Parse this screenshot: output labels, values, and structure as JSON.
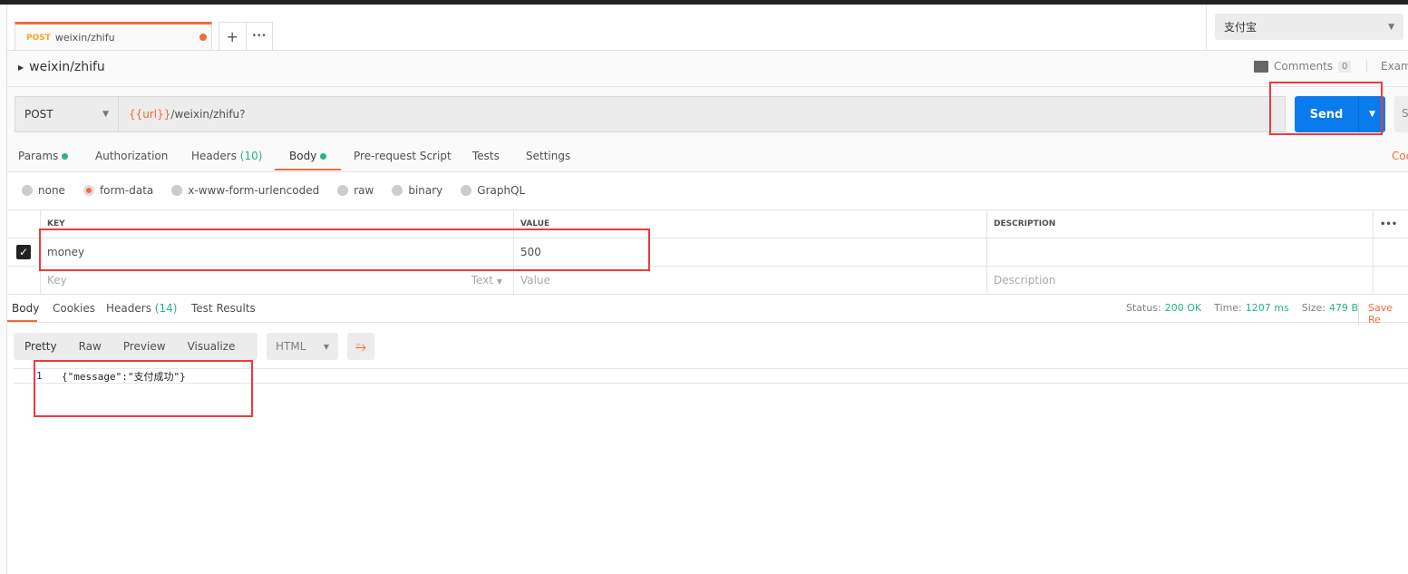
{
  "tab": {
    "method": "POST",
    "name": "weixin/zhifu",
    "add": "+",
    "more": "•••"
  },
  "environment": {
    "selected": "支付宝"
  },
  "breadcrumb": "weixin/zhifu",
  "comments": {
    "label": "Comments",
    "count": "0"
  },
  "examples_label": "Exam",
  "request": {
    "method": "POST",
    "url_var": "{{url}}",
    "url_path": "/weixin/zhifu?",
    "send": "Send",
    "save": "S"
  },
  "req_tabs": {
    "params": "Params",
    "authorization": "Authorization",
    "headers": "Headers",
    "headers_count": "(10)",
    "body": "Body",
    "prerequest": "Pre-request Script",
    "tests": "Tests",
    "settings": "Settings",
    "code": "Coo"
  },
  "body_types": [
    "none",
    "form-data",
    "x-www-form-urlencoded",
    "raw",
    "binary",
    "GraphQL"
  ],
  "body_type_selected": "form-data",
  "table": {
    "headers": {
      "key": "KEY",
      "value": "VALUE",
      "description": "DESCRIPTION",
      "more": "•••"
    },
    "rows": [
      {
        "checked": true,
        "key": "money",
        "value": "500",
        "description": ""
      }
    ],
    "placeholder": {
      "key": "Key",
      "type": "Text",
      "value": "Value",
      "description": "Description"
    }
  },
  "resp_tabs": {
    "body": "Body",
    "cookies": "Cookies",
    "headers": "Headers",
    "headers_count": "(14)",
    "tests": "Test Results"
  },
  "status": {
    "status_label": "Status:",
    "status": "200 OK",
    "time_label": "Time:",
    "time": "1207 ms",
    "size_label": "Size:",
    "size": "479 B",
    "save": "Save Re"
  },
  "view": {
    "pretty": "Pretty",
    "raw": "Raw",
    "preview": "Preview",
    "visualize": "Visualize",
    "format": "HTML"
  },
  "response": {
    "line": "1",
    "text": "{\"message\":\"支付成功\"}"
  },
  "colors": {
    "accent": "#f26b3a",
    "send": "#097bed",
    "success": "#26b47f",
    "annotation": "#f03a3a"
  }
}
